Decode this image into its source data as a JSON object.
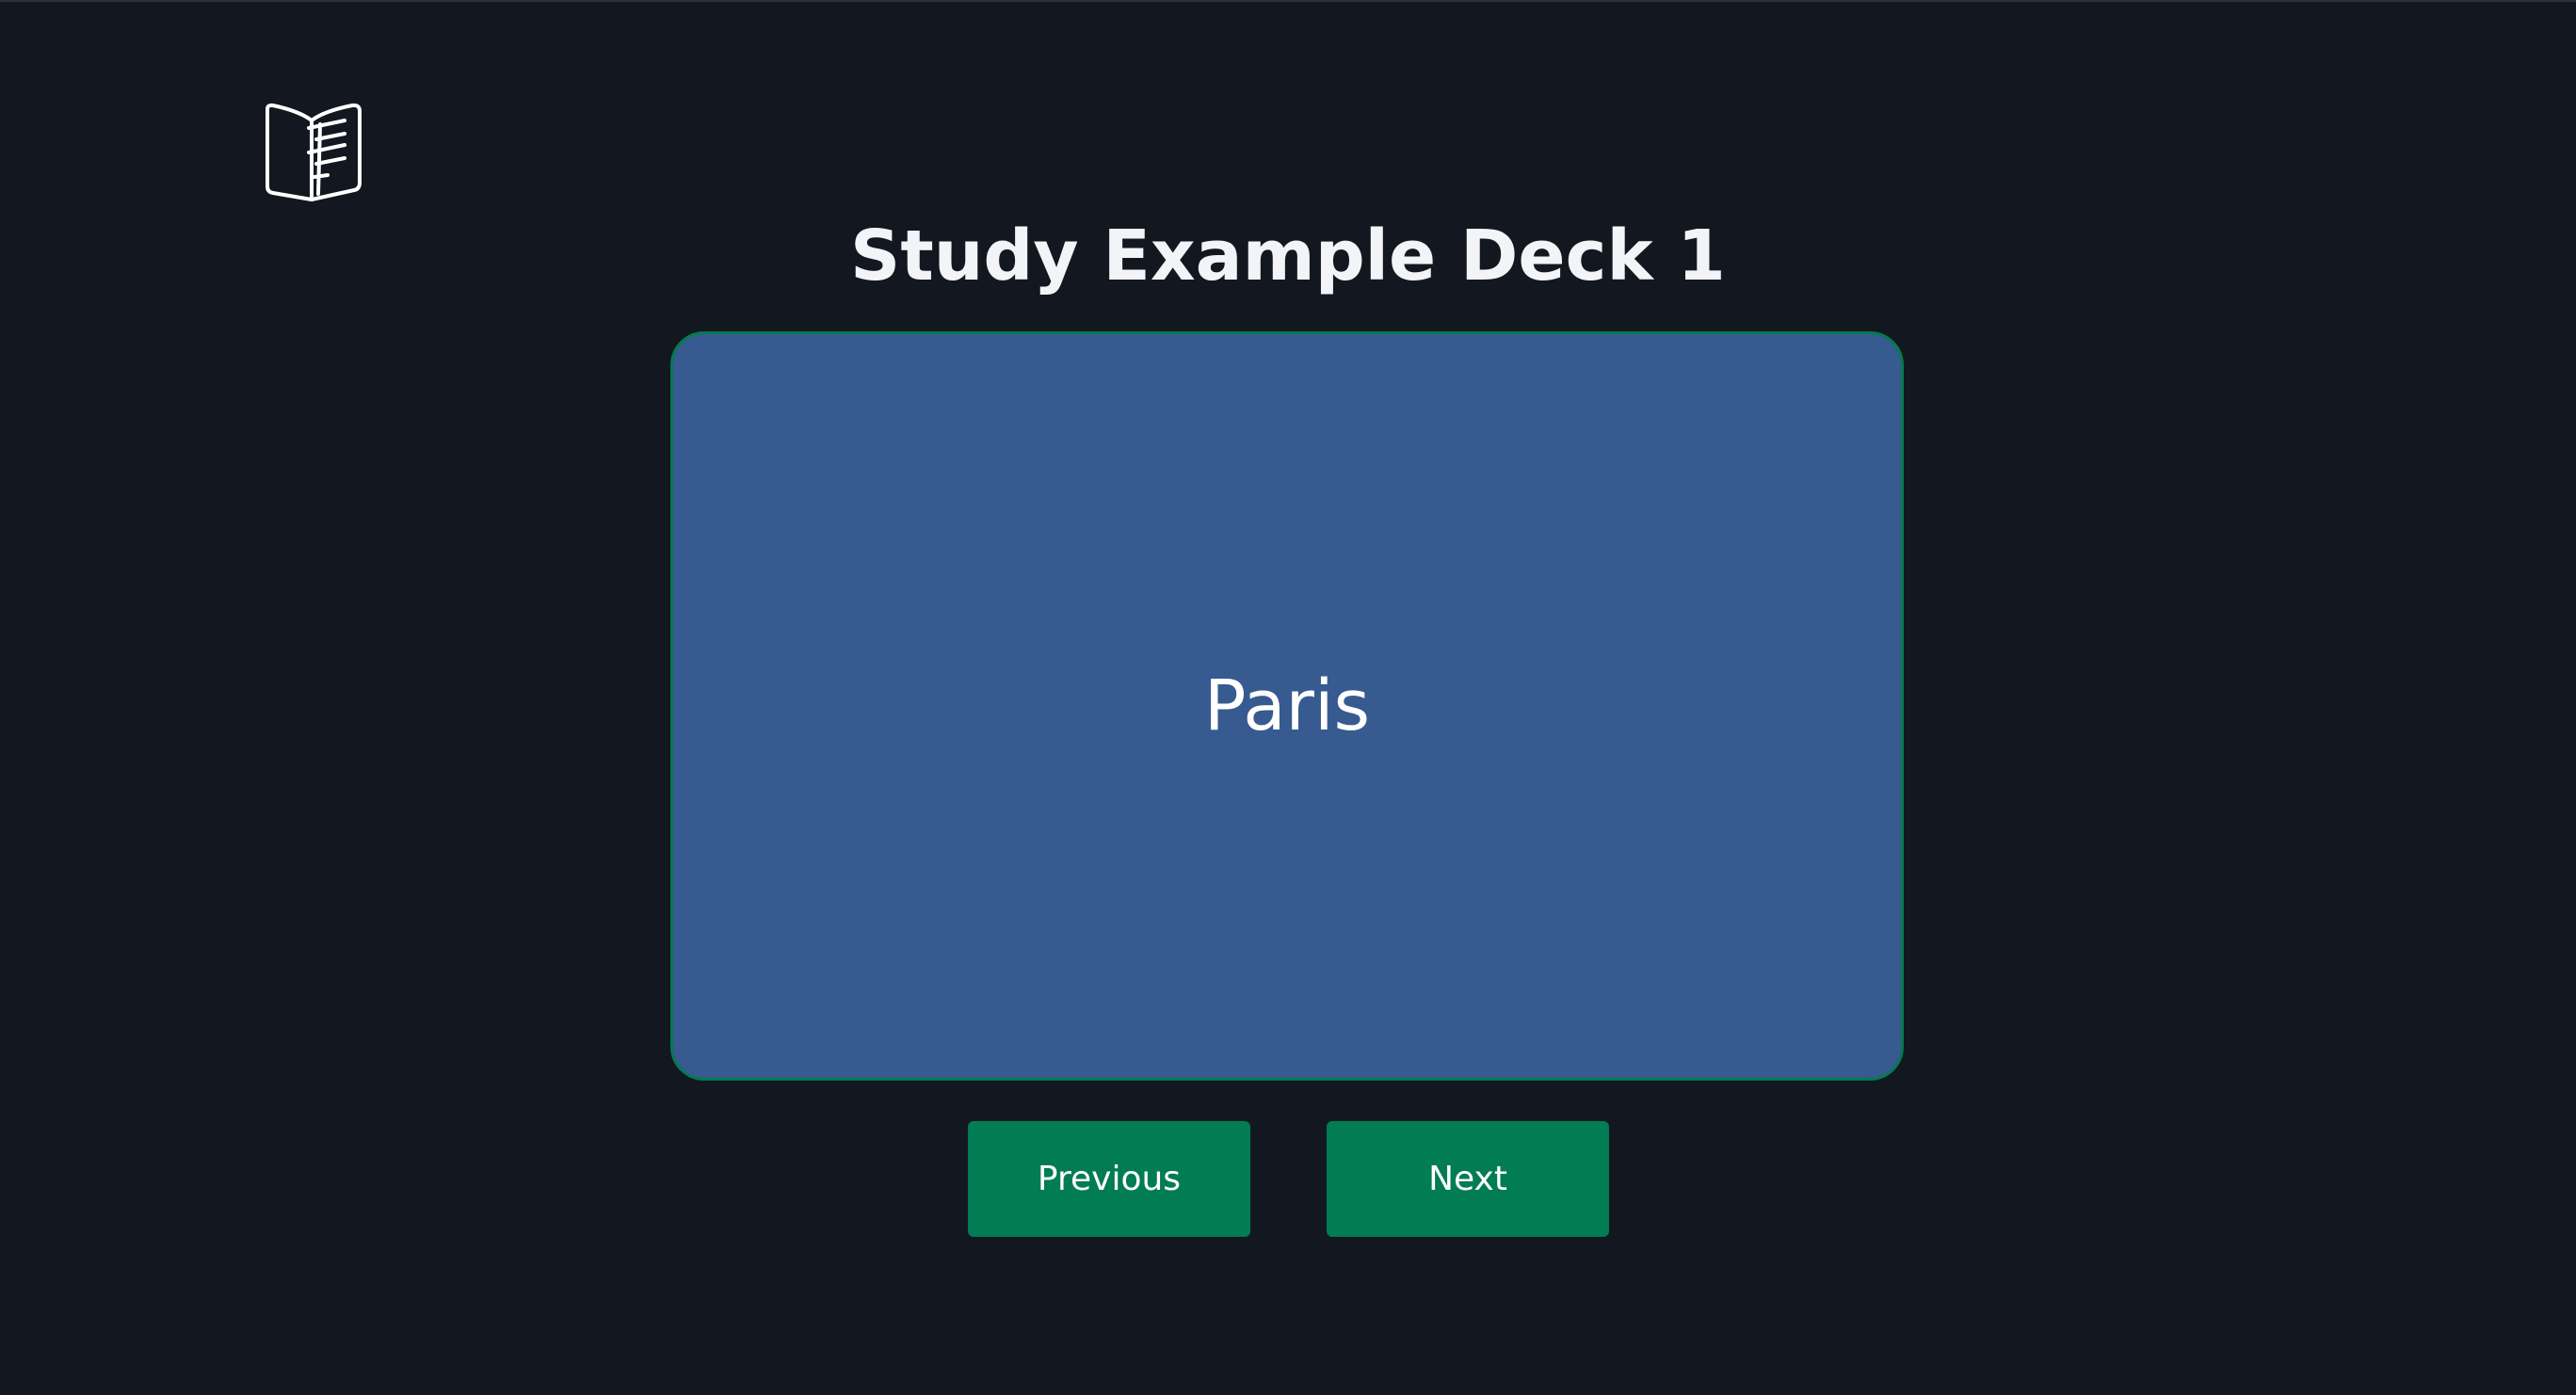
{
  "header": {
    "logo_icon": "open-book-icon"
  },
  "page": {
    "title": "Study Example Deck 1"
  },
  "card": {
    "text": "Paris"
  },
  "controls": {
    "previous_label": "Previous",
    "next_label": "Next"
  },
  "colors": {
    "background": "#131820",
    "card": "#375a91",
    "card_border": "#057a4f",
    "button": "#027c52",
    "text": "#f2f4f7"
  }
}
